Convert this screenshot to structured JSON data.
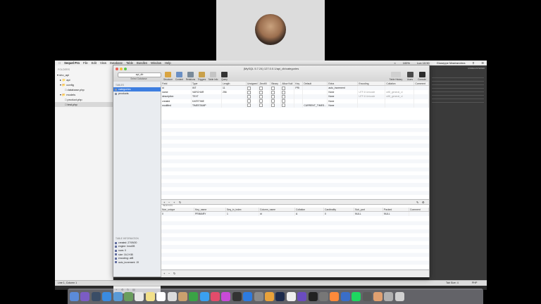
{
  "menubar": {
    "app_name": "Sequel Pro",
    "items": [
      "File",
      "Edit",
      "View",
      "Database",
      "Table",
      "Bundles",
      "Window",
      "Help"
    ],
    "clock": "Lun 10:50",
    "user": "Giuseppe Mastrandrea",
    "battery": "100%"
  },
  "editor": {
    "folders_heading": "FOLDERS",
    "tree": [
      {
        "label": "sho_api",
        "level": 0
      },
      {
        "label": "api",
        "level": 1
      },
      {
        "label": "config",
        "level": 1
      },
      {
        "label": "database.php",
        "level": 2
      },
      {
        "label": "models",
        "level": 1
      },
      {
        "label": "product.php",
        "level": 2
      },
      {
        "label": "test.php",
        "level": 2,
        "selected": true
      }
    ],
    "status_left": "Line 1, Column 1",
    "status_right_a": "Tab Size: 4",
    "status_right_b": "PHP",
    "right_label": "UNREGISTERED"
  },
  "window": {
    "title": "(MySQL 5.7.24) 127.0.0.1/api_db/categories",
    "database": "api_db",
    "database_label": "Select Database",
    "toolbar": [
      {
        "label": "Structure",
        "color": "#d9a441"
      },
      {
        "label": "Content",
        "color": "#6a8fc4"
      },
      {
        "label": "Relations",
        "color": "#7a8a9a"
      },
      {
        "label": "Triggers",
        "color": "#c9a04a"
      },
      {
        "label": "Table Info",
        "color": "#c4c4c4"
      },
      {
        "label": "Query",
        "color": "#333333"
      }
    ],
    "toolbar_right": [
      {
        "label": "Table History"
      },
      {
        "label": "Users"
      },
      {
        "label": "Console"
      }
    ],
    "tables_heading": "TABLES",
    "tables": [
      {
        "name": "categories",
        "selected": true
      },
      {
        "name": "products",
        "selected": false
      }
    ],
    "table_info_heading": "TABLE INFORMATION",
    "table_info": [
      "created: 27/09/20",
      "engine: InnoDB",
      "rows: 0",
      "size: 16,0 KiB",
      "encoding: utf8",
      "auto_increment: 19"
    ],
    "structure": {
      "columns": [
        "Field",
        "Type",
        "Length",
        "Unsigned",
        "Zerofill",
        "Binary",
        "Allow Null",
        "Key",
        "Default",
        "Extra",
        "Encoding",
        "Collation",
        "Comment"
      ],
      "rows": [
        {
          "field": "id",
          "type": "INT",
          "length": "11",
          "unsigned": false,
          "zerofill": false,
          "binary": false,
          "allow_null": false,
          "key": "PRI",
          "default": "",
          "extra": "auto_increment",
          "encoding": "",
          "collation": "",
          "comment": ""
        },
        {
          "field": "name",
          "type": "VARCHAR",
          "length": "256",
          "unsigned": false,
          "zerofill": false,
          "binary": false,
          "allow_null": false,
          "key": "",
          "default": "",
          "extra": "None",
          "encoding": "UTF-8 Unicode",
          "collation": "utf8_general_ci",
          "comment": ""
        },
        {
          "field": "description",
          "type": "TEXT",
          "length": "",
          "unsigned": false,
          "zerofill": false,
          "binary": false,
          "allow_null": false,
          "key": "",
          "default": "",
          "extra": "None",
          "encoding": "UTF-8 Unicode",
          "collation": "utf8_general_ci",
          "comment": ""
        },
        {
          "field": "created",
          "type": "DATETIME",
          "length": "",
          "unsigned": false,
          "zerofill": false,
          "binary": false,
          "allow_null": false,
          "key": "",
          "default": "",
          "extra": "None",
          "encoding": "",
          "collation": "",
          "comment": ""
        },
        {
          "field": "modified",
          "type": "TIMESTAMP",
          "length": "",
          "unsigned": false,
          "zerofill": false,
          "binary": false,
          "allow_null": false,
          "key": "",
          "default": "CURRENT_TIMES...",
          "extra": "None",
          "encoding": "",
          "collation": "",
          "comment": ""
        }
      ]
    },
    "indexes_heading": "INDEXES",
    "indexes": {
      "columns": [
        "Non_unique",
        "Key_name",
        "Seq_in_index",
        "Column_name",
        "Collation",
        "Cardinality",
        "Sub_part",
        "Packed",
        "Comment"
      ],
      "rows": [
        {
          "non_unique": "0",
          "key_name": "PRIMARY",
          "seq": "1",
          "column": "id",
          "collation": "A",
          "cardinality": "0",
          "sub_part": "NULL",
          "packed": "NULL",
          "comment": ""
        }
      ]
    }
  }
}
